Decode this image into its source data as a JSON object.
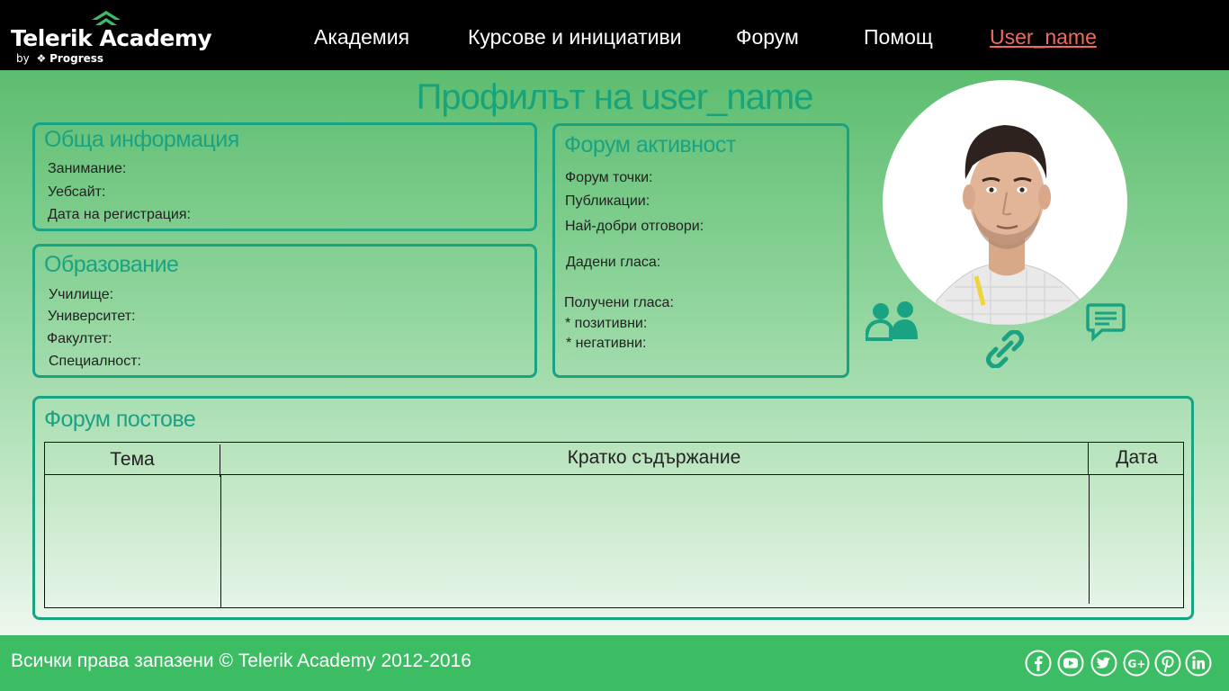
{
  "header": {
    "logo": {
      "name": "Telerik Academy",
      "sub_by": "by",
      "sub_brand": "Progress"
    },
    "nav": [
      {
        "label": "Академия"
      },
      {
        "label": "Курсове и инициативи"
      },
      {
        "label": "Форум"
      },
      {
        "label": "Помощ"
      }
    ],
    "user_link": "User_name",
    "user_link_color": "#f16a5e"
  },
  "page": {
    "title": "Профилът на user_name",
    "accent": "#1aa383"
  },
  "general_info": {
    "title": "Обща информация",
    "fields": [
      "Занимание:",
      "Уебсайт:",
      "Дата на регистрация:"
    ]
  },
  "education": {
    "title": "Образование",
    "fields": [
      "Училище:",
      "Университет:",
      "Факултет:",
      "Специалност:"
    ]
  },
  "forum_activity": {
    "title": "Форум активност",
    "fields": [
      "Форум точки:",
      "Публикации:",
      "Най-добри отговори:",
      "Дадени гласа:",
      "Получени гласа:",
      "* позитивни:",
      "* негативни:"
    ]
  },
  "profile_actions": {
    "icons": [
      "add-friend-icon",
      "link-icon",
      "message-icon"
    ]
  },
  "forum_posts": {
    "title": "Форум постове",
    "columns": [
      "Тема",
      "Кратко съдържание",
      "Дата"
    ],
    "rows": []
  },
  "footer": {
    "copyright": "Всички права запазени © Telerik Academy 2012-2016",
    "social": [
      "facebook-icon",
      "youtube-icon",
      "twitter-icon",
      "google-plus-icon",
      "pinterest-icon",
      "linkedin-icon"
    ],
    "bg_color": "#3cbd63"
  }
}
